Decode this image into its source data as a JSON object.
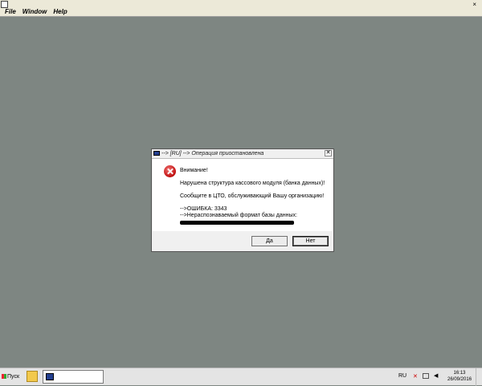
{
  "app": {
    "menu": [
      "File",
      "Window",
      "Help"
    ],
    "close_glyph": "×"
  },
  "dialog": {
    "title": "--> [RU] --> Операция приостановлена",
    "close_glyph": "✕",
    "lines": [
      "Внимание!",
      "Нарушена структура кассового модуля (банка данных)!",
      "Сообщите в ЦТО, обслуживающий Вашу организацию!",
      "-->ОШИБКА: 3343",
      "-->Нераспознаваемый формат базы данных:"
    ],
    "buttons": {
      "yes": "Да",
      "no": "Нет"
    },
    "icon": "error-icon"
  },
  "taskbar": {
    "start_label": "Пуск",
    "language": "RU",
    "time": "16:13",
    "date": "26/09/2016"
  }
}
